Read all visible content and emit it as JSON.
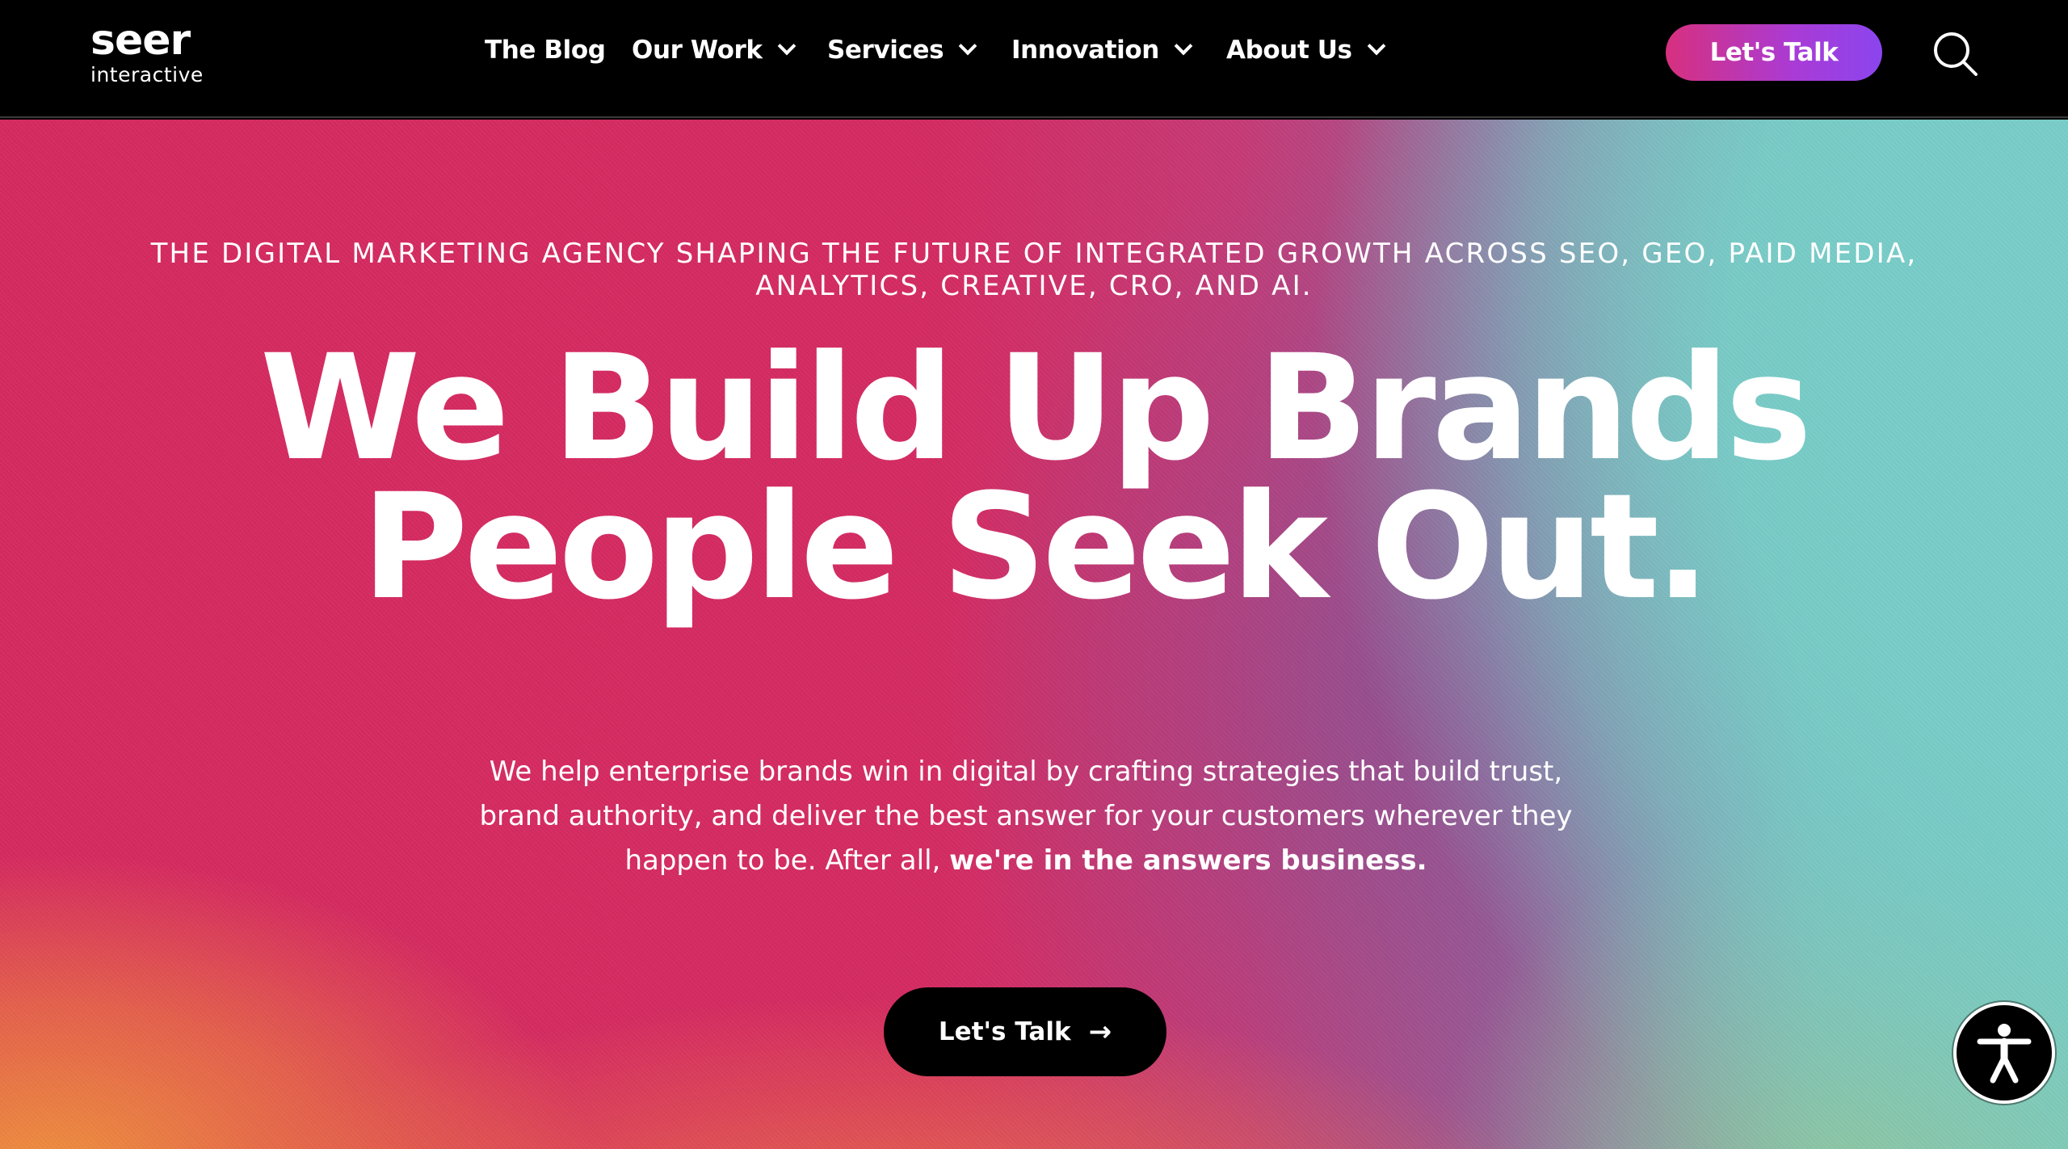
{
  "header": {
    "logo": {
      "main": "seer",
      "sub": "interactive"
    },
    "nav": [
      {
        "label": "The Blog",
        "has_dropdown": false
      },
      {
        "label": "Our Work",
        "has_dropdown": true
      },
      {
        "label": "Services",
        "has_dropdown": true
      },
      {
        "label": "Innovation",
        "has_dropdown": true
      },
      {
        "label": "About Us",
        "has_dropdown": true
      }
    ],
    "cta_label": "Let's Talk",
    "search_icon": "search-icon"
  },
  "hero": {
    "eyebrow": "The digital marketing agency shaping the future of integrated growth across SEO, GEO, Paid Media, Analytics, Creative, CRO, and AI.",
    "headline_line1": "We Build Up Brands",
    "headline_line2": "People Seek Out.",
    "lead_text": "We help enterprise brands win in digital by crafting strategies that build trust, brand authority, and deliver the best answer for your customers wherever they happen to be. After all, ",
    "lead_emphasis": "we're in the answers business.",
    "cta_label": "Let's Talk",
    "cta_arrow": "→"
  },
  "accessibility": {
    "icon": "accessibility-icon"
  },
  "colors": {
    "header_bg": "#000000",
    "cta_gradient_start": "#d7307e",
    "cta_gradient_end": "#8b45ee",
    "hero_pink": "#d52a60",
    "hero_teal": "#76cbc5",
    "hero_orange": "#f0963c",
    "text": "#ffffff"
  }
}
